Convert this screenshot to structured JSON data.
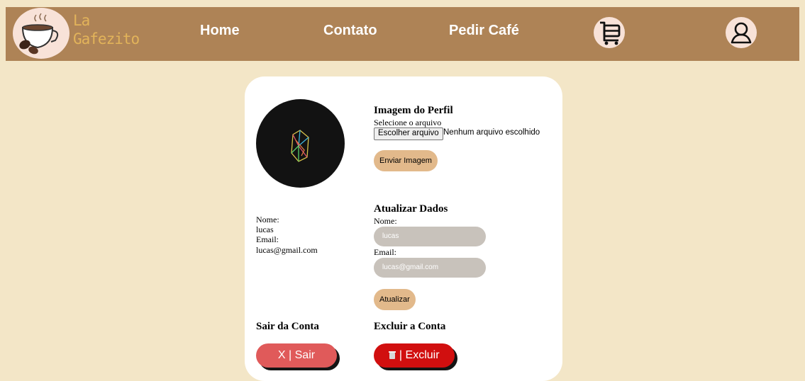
{
  "brand": {
    "name_line1": "La",
    "name_line2": "Gafezito"
  },
  "nav": {
    "home": "Home",
    "contato": "Contato",
    "pedir": "Pedir Café"
  },
  "icons": {
    "cart": "cart-icon",
    "user": "user-icon",
    "trash": "trash-icon",
    "logo": "coffee-cup-logo"
  },
  "profile_image": {
    "heading": "Imagem do Perfil",
    "select_label": "Selecione o arquivo",
    "file_button": "Escolher arquivo",
    "file_status": "Nenhum arquivo escolhido",
    "send_button": "Enviar Imagem"
  },
  "user_info": {
    "name_label": "Nome:",
    "name_value": "lucas",
    "email_label": "Email:",
    "email_value": "lucas@gmail.com"
  },
  "update": {
    "heading": "Atualizar Dados",
    "name_label": "Nome:",
    "name_placeholder": "lucas",
    "email_label": "Email:",
    "email_placeholder": "lucas@gmail.com",
    "submit_button": "Atualizar"
  },
  "logout": {
    "heading": "Sair da Conta",
    "button": "X | Sair"
  },
  "delete": {
    "heading": "Excluir a Conta",
    "button": "| Excluir"
  },
  "colors": {
    "navbar": "#ae8356",
    "background": "#f3e6c7",
    "accent_button": "#e2b98b",
    "logout_button": "#e05a5a",
    "delete_button": "#d10f0f",
    "logo_text": "#e2b35a"
  }
}
